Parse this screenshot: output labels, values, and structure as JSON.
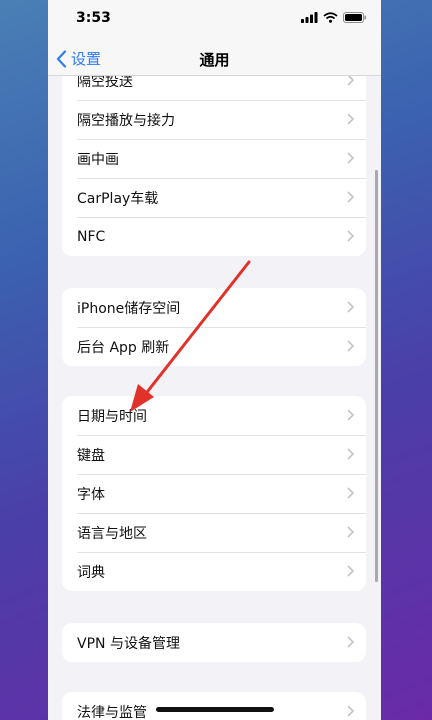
{
  "status": {
    "time": "3:53"
  },
  "nav": {
    "back_label": "设置",
    "title": "通用"
  },
  "groups": [
    {
      "items": [
        "隔空投送",
        "隔空播放与接力",
        "画中画",
        "CarPlay车载",
        "NFC"
      ]
    },
    {
      "items": [
        "iPhone储存空间",
        "后台 App 刷新"
      ]
    },
    {
      "items": [
        "日期与时间",
        "键盘",
        "字体",
        "语言与地区",
        "词典"
      ]
    },
    {
      "items": [
        "VPN 与设备管理"
      ]
    },
    {
      "items": [
        "法律与监管"
      ]
    }
  ],
  "colors": {
    "accent": "#2f7cf6",
    "annotation_arrow": "#e0322a"
  },
  "icons": [
    "back-chevron-icon",
    "chevron-right-icon",
    "signal-icon",
    "wifi-icon",
    "battery-icon"
  ]
}
